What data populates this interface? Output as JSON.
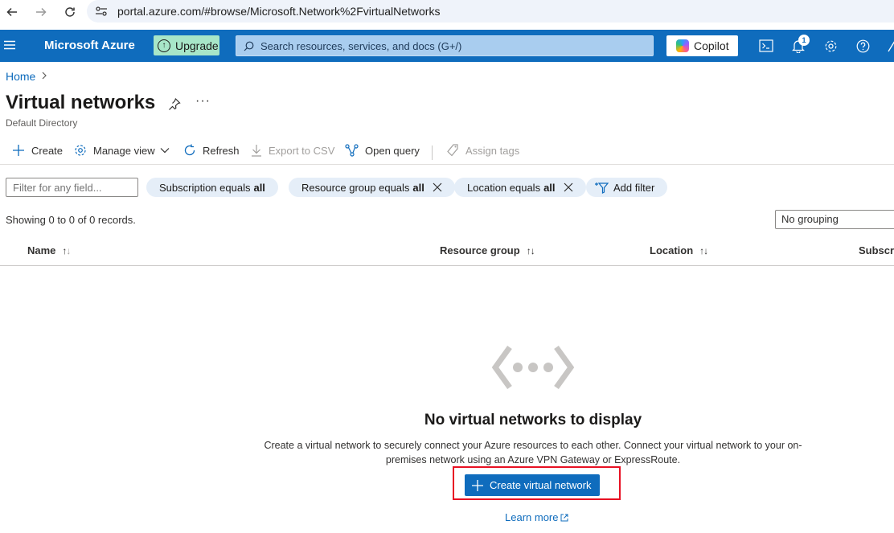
{
  "browser": {
    "url": "portal.azure.com/#browse/Microsoft.Network%2FvirtualNetworks"
  },
  "header": {
    "brand": "Microsoft Azure",
    "upgrade_label": "Upgrade",
    "search_placeholder": "Search resources, services, and docs (G+/)",
    "copilot_label": "Copilot",
    "notification_count": "1",
    "icons": [
      "hamburger-icon",
      "cloud-shell-icon",
      "bell-icon",
      "gear-icon",
      "help-icon",
      "feedback-icon"
    ]
  },
  "breadcrumb": {
    "home": "Home"
  },
  "page": {
    "title": "Virtual networks",
    "more": "···",
    "subtitle": "Default Directory"
  },
  "toolbar": {
    "create": "Create",
    "manage_view": "Manage view",
    "refresh": "Refresh",
    "export_csv": "Export to CSV",
    "open_query": "Open query",
    "assign_tags": "Assign tags"
  },
  "filters": {
    "input_placeholder": "Filter for any field...",
    "subscription_label": "Subscription equals",
    "subscription_value": "all",
    "resource_group_label": "Resource group equals",
    "resource_group_value": "all",
    "location_label": "Location equals",
    "location_value": "all",
    "add_filter": "Add filter"
  },
  "list": {
    "records_text": "Showing 0 to 0 of 0 records.",
    "grouping_value": "No grouping",
    "columns": [
      "Name",
      "Resource group",
      "Location",
      "Subscripti"
    ]
  },
  "empty_state": {
    "title": "No virtual networks to display",
    "description": "Create a virtual network to securely connect your Azure resources to each other. Connect your virtual network to your on-premises network using an Azure VPN Gateway or ExpressRoute.",
    "cta_label": "Create virtual network",
    "learn_more": "Learn more"
  },
  "colors": {
    "azure_blue": "#0f6cbd",
    "upgrade_green": "#a8e6c8",
    "highlight_red": "#e81123"
  }
}
